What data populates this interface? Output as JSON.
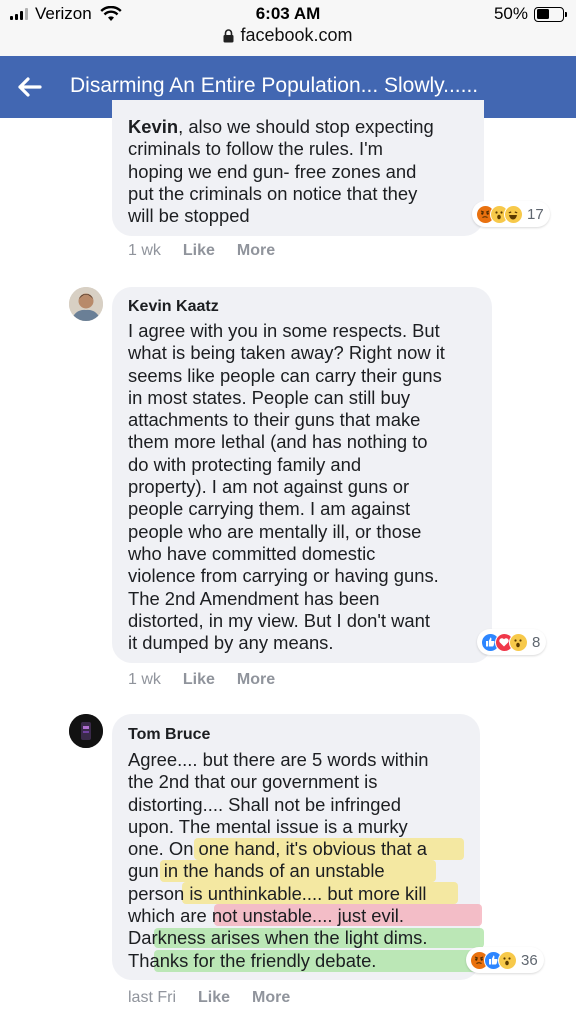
{
  "status_bar": {
    "carrier": "Verizon",
    "time": "6:03 AM",
    "battery": "50%",
    "battery_level": 0.5,
    "url": "facebook.com"
  },
  "header": {
    "title": "Disarming An Entire Population... Slowly......"
  },
  "comments": [
    {
      "author_bold": "Kevin",
      "lines": [
        ", also we should stop expecting",
        "criminals to follow the rules. I'm",
        "hoping we end gun- free zones and",
        "put the criminals on notice that they",
        "will be stopped"
      ],
      "reaction_count": "17",
      "time": "1 wk",
      "like": "Like",
      "more": "More"
    },
    {
      "author": "Kevin Kaatz",
      "lines": [
        "I agree with you in some respects. But",
        "what is being taken away? Right now it",
        "seems like people can carry their guns",
        "in most states. People can still buy",
        "attachments to their guns that make",
        "them more lethal (and has nothing to",
        "do with protecting family and",
        "property). I am not against guns or",
        "people carrying them. I am against",
        "people who are mentally ill, or those",
        "who have committed domestic",
        "violence from carrying or having guns.",
        "The 2nd Amendment has been",
        "distorted, in my view. But I don't want",
        "it dumped by any means."
      ],
      "reaction_count": "8",
      "time": "1 wk",
      "like": "Like",
      "more": "More"
    },
    {
      "author": "Tom Bruce",
      "lines": [
        "Agree.... but there are 5 words within",
        "the 2nd that our government is",
        "distorting.... Shall not be infringed",
        "upon. The mental issue is a murky",
        "one. On one hand, it's obvious that a",
        "gun in the hands of an unstable",
        "person is unthinkable.... but more kill",
        "which are not unstable.... just evil.",
        "Darkness arises when the light dims.",
        "Thanks for the friendly debate."
      ],
      "reaction_count": "36",
      "time": "last Fri",
      "like": "Like",
      "more": "More"
    }
  ],
  "colors": {
    "header_bg": "#4267b2",
    "bubble_bg": "#f0f1f5",
    "highlight_yellow": "#f7e26b",
    "highlight_pink": "#f3a6b4",
    "highlight_green": "#a9e3a0"
  },
  "icons": [
    "back-arrow-icon",
    "wifi-icon",
    "lock-icon",
    "angry-reaction-icon",
    "wow-reaction-icon",
    "haha-reaction-icon",
    "like-reaction-icon",
    "love-reaction-icon"
  ]
}
